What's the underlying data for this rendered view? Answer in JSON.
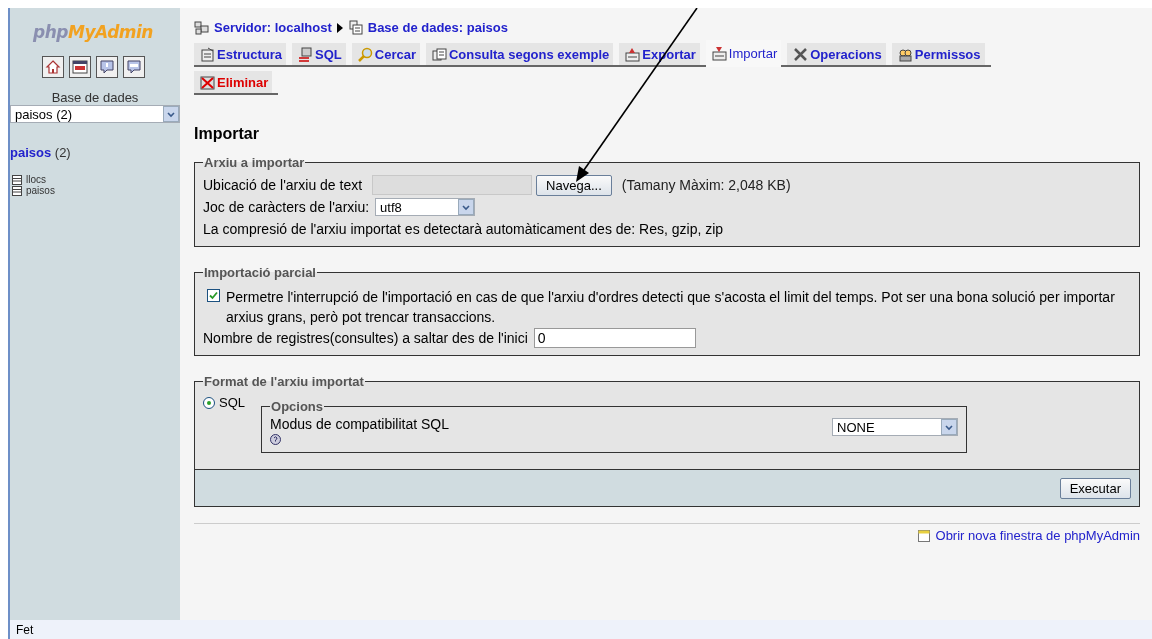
{
  "sidebar": {
    "logo_prefix": "php",
    "logo_name": "MyAdmin",
    "database_label": "Base de dades",
    "database_select": "paisos (2)",
    "database_link": {
      "name": "paisos",
      "count": "(2)"
    },
    "tables": [
      "llocs",
      "paisos"
    ]
  },
  "breadcrumb": [
    {
      "label": "Servidor: localhost"
    },
    {
      "label": "Base de dades: paisos"
    }
  ],
  "tabs": [
    {
      "label": "Estructura",
      "selected": false,
      "kind": "normal"
    },
    {
      "label": "SQL",
      "selected": false,
      "kind": "normal"
    },
    {
      "label": "Cercar",
      "selected": false,
      "kind": "normal"
    },
    {
      "label": "Consulta segons exemple",
      "selected": false,
      "kind": "normal"
    },
    {
      "label": "Exportar",
      "selected": false,
      "kind": "normal"
    },
    {
      "label": "Importar",
      "selected": true,
      "kind": "normal"
    },
    {
      "label": "Operacions",
      "selected": false,
      "kind": "normal"
    },
    {
      "label": "Permissos",
      "selected": false,
      "kind": "normal"
    },
    {
      "label": "Eliminar",
      "selected": false,
      "kind": "danger"
    }
  ],
  "heading": "Importar",
  "file_section": {
    "legend": "Arxiu a importar",
    "file_label": "Ubicació de l'arxiu de text",
    "browse_button": "Navega...",
    "max_size": "(Tamany Màxim: 2,048 KB)",
    "charset_label": "Joc de caràcters de l'arxiu:",
    "charset_value": "utf8",
    "compression_note": "La compresió de l'arxiu importat es detectarà automàticament des de: Res, gzip, zip"
  },
  "partial_section": {
    "legend": "Importació parcial",
    "allow_interrupt": {
      "label": "Permetre l'interrupció de l'importació en cas de que l'arxiu d'ordres detecti que s'acosta el limit del temps. Pot ser una bona solució per importar arxius grans, però pot trencar transaccions.",
      "checked": true
    },
    "skip_label": "Nombre de registres(consultes) a saltar des de l'inici",
    "skip_value": "0"
  },
  "format_section": {
    "legend": "Format de l'arxiu importat",
    "formats": [
      {
        "label": "SQL",
        "selected": true
      }
    ],
    "options_legend": "Opcions",
    "compat_label": "Modus de compatibilitat SQL",
    "compat_value": "NONE",
    "submit_button": "Executar"
  },
  "new_window_link": "Obrir nova finestra de phpMyAdmin",
  "status_bar": "Fet"
}
